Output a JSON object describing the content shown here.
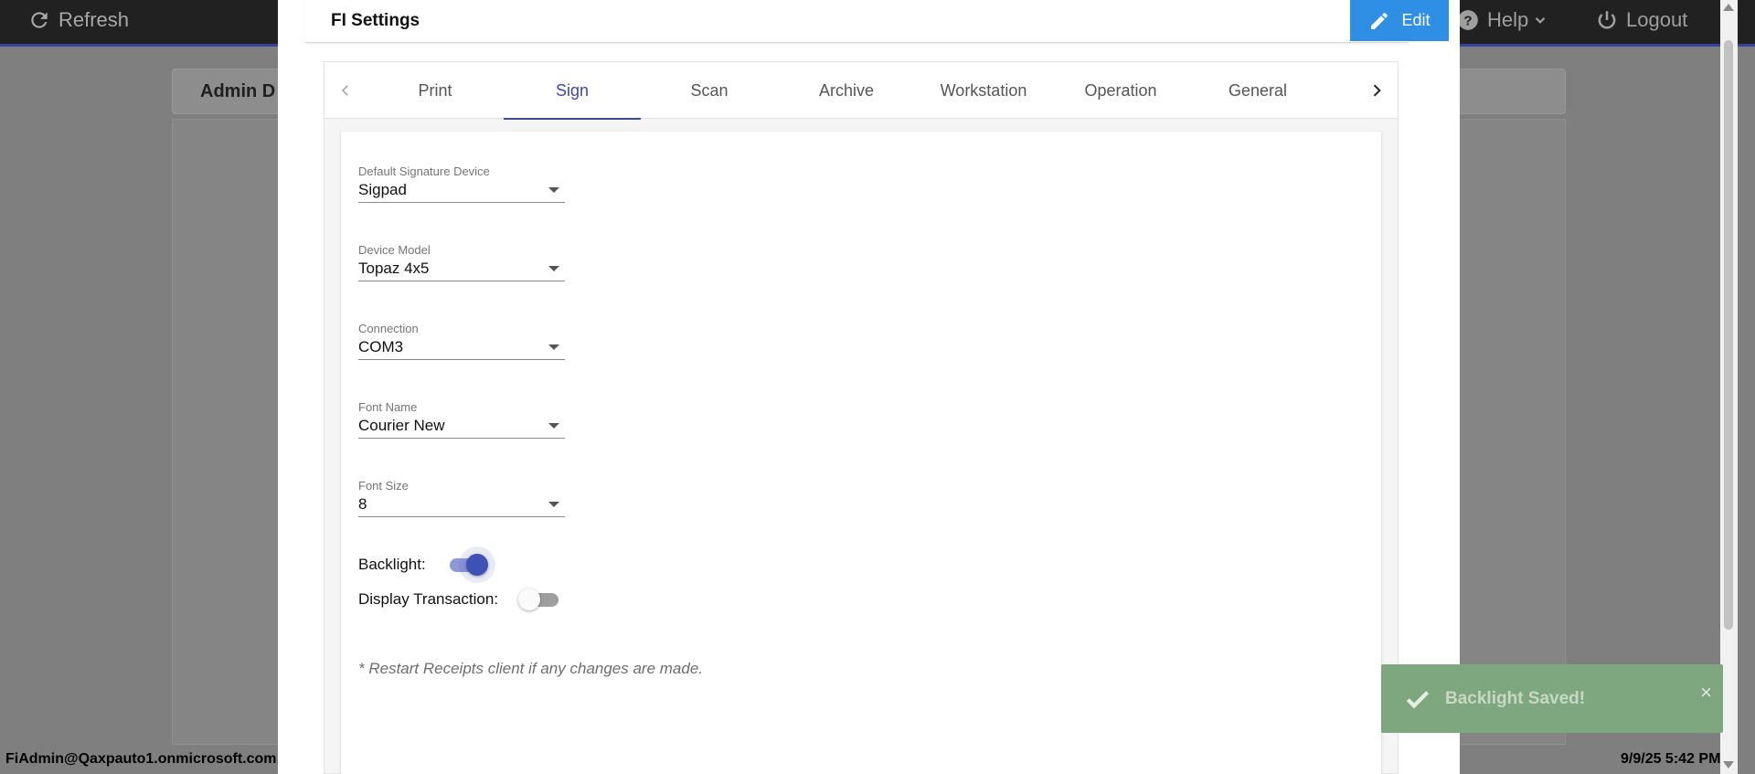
{
  "app": {
    "refresh_label": "Refresh",
    "help_label": "Help",
    "logout_label": "Logout",
    "admin_card_title": "Admin D",
    "user_email": "FiAdmin@Qaxpauto1.onmicrosoft.com",
    "datetime": "9/9/25 5:42 PM"
  },
  "modal": {
    "title": "FI Settings",
    "edit_label": "Edit",
    "tabs": [
      "Print",
      "Sign",
      "Scan",
      "Archive",
      "Workstation",
      "Operation",
      "General"
    ],
    "active_tab": "Sign"
  },
  "sign_settings": {
    "default_device": {
      "label": "Default Signature Device",
      "value": "Sigpad"
    },
    "device_model": {
      "label": "Device Model",
      "value": "Topaz 4x5"
    },
    "connection": {
      "label": "Connection",
      "value": "COM3"
    },
    "font_name": {
      "label": "Font Name",
      "value": "Courier New"
    },
    "font_size": {
      "label": "Font Size",
      "value": "8"
    },
    "backlight": {
      "label": "Backlight:",
      "on": true
    },
    "display_transaction": {
      "label": "Display Transaction:",
      "on": false
    },
    "note": "* Restart Receipts client if any changes are made."
  },
  "toast": {
    "message": "Backlight Saved!",
    "close": "×"
  },
  "colors": {
    "accent": "#3f51b5",
    "edit_button": "#2f8fe4",
    "toast_bg": "#7fa77f"
  }
}
